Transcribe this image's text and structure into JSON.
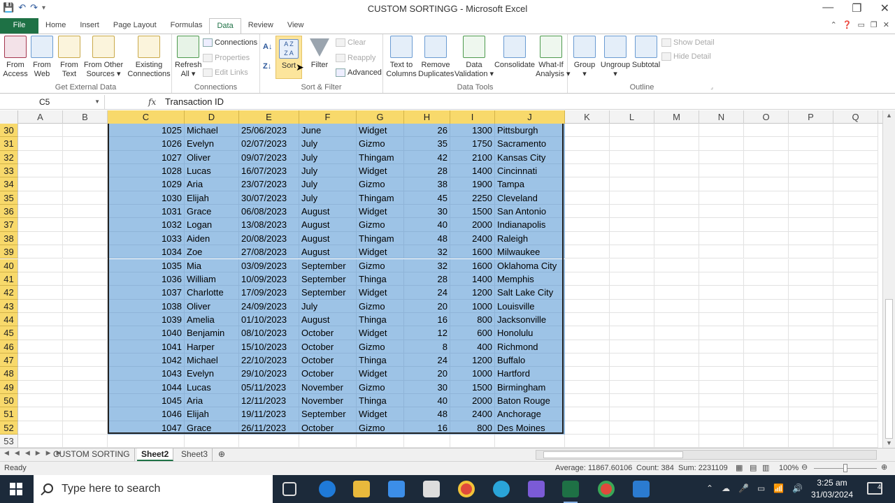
{
  "window": {
    "title": "CUSTOM SORTINGG - Microsoft Excel",
    "minimize": "—",
    "restore": "❐",
    "close": "✕"
  },
  "ribbon_tabs": [
    "File",
    "Home",
    "Insert",
    "Page Layout",
    "Formulas",
    "Data",
    "Review",
    "View"
  ],
  "active_tab": "Data",
  "ribbon": {
    "get_external_data": {
      "label": "Get External Data",
      "from_access": "From\nAccess",
      "from_web": "From\nWeb",
      "from_text": "From\nText",
      "from_other": "From Other\nSources ▾",
      "existing": "Existing\nConnections"
    },
    "connections": {
      "label": "Connections",
      "refresh": "Refresh\nAll ▾",
      "connections": "Connections",
      "properties": "Properties",
      "edit_links": "Edit Links"
    },
    "sort_filter": {
      "label": "Sort & Filter",
      "sort": "Sort",
      "filter": "Filter",
      "clear": "Clear",
      "reapply": "Reapply",
      "advanced": "Advanced"
    },
    "data_tools": {
      "label": "Data Tools",
      "text_to_columns": "Text to\nColumns",
      "remove_duplicates": "Remove\nDuplicates",
      "data_validation": "Data\nValidation ▾",
      "consolidate": "Consolidate",
      "what_if": "What-If\nAnalysis ▾"
    },
    "outline": {
      "label": "Outline",
      "group": "Group\n▾",
      "ungroup": "Ungroup\n▾",
      "subtotal": "Subtotal",
      "show_detail": "Show Detail",
      "hide_detail": "Hide Detail"
    }
  },
  "formula_bar": {
    "name_box": "C5",
    "fx": "fx",
    "formula": "Transaction ID"
  },
  "columns": [
    "A",
    "B",
    "C",
    "D",
    "E",
    "F",
    "G",
    "H",
    "I",
    "J",
    "K",
    "L",
    "M",
    "N",
    "O",
    "P",
    "Q"
  ],
  "rows": [
    {
      "n": "30",
      "cells": [
        "1025",
        "Michael",
        "25/06/2023",
        "June",
        "Widget",
        "26",
        "1300",
        "Pittsburgh"
      ]
    },
    {
      "n": "31",
      "cells": [
        "1026",
        "Evelyn",
        "02/07/2023",
        "July",
        "Gizmo",
        "35",
        "1750",
        "Sacramento"
      ]
    },
    {
      "n": "32",
      "cells": [
        "1027",
        "Oliver",
        "09/07/2023",
        "July",
        "Thingam",
        "42",
        "2100",
        "Kansas City"
      ]
    },
    {
      "n": "33",
      "cells": [
        "1028",
        "Lucas",
        "16/07/2023",
        "July",
        "Widget",
        "28",
        "1400",
        "Cincinnati"
      ]
    },
    {
      "n": "34",
      "cells": [
        "1029",
        "Aria",
        "23/07/2023",
        "July",
        "Gizmo",
        "38",
        "1900",
        "Tampa"
      ]
    },
    {
      "n": "35",
      "cells": [
        "1030",
        "Elijah",
        "30/07/2023",
        "July",
        "Thingam",
        "45",
        "2250",
        "Cleveland"
      ]
    },
    {
      "n": "36",
      "cells": [
        "1031",
        "Grace",
        "06/08/2023",
        "August",
        "Widget",
        "30",
        "1500",
        "San Antonio"
      ]
    },
    {
      "n": "37",
      "cells": [
        "1032",
        "Logan",
        "13/08/2023",
        "August",
        "Gizmo",
        "40",
        "2000",
        "Indianapolis"
      ]
    },
    {
      "n": "38",
      "cells": [
        "1033",
        "Aiden",
        "20/08/2023",
        "August",
        "Thingam",
        "48",
        "2400",
        "Raleigh"
      ]
    },
    {
      "n": "39",
      "cells": [
        "1034",
        "Zoe",
        "27/08/2023",
        "August",
        "Widget",
        "32",
        "1600",
        "Milwaukee"
      ]
    },
    {
      "n": "40",
      "cells": [
        "1035",
        "Mia",
        "03/09/2023",
        "September",
        "Gizmo",
        "32",
        "1600",
        "Oklahoma City"
      ]
    },
    {
      "n": "41",
      "cells": [
        "1036",
        "William",
        "10/09/2023",
        "September",
        "Thinga",
        "28",
        "1400",
        "Memphis"
      ]
    },
    {
      "n": "42",
      "cells": [
        "1037",
        "Charlotte",
        "17/09/2023",
        "September",
        "Widget",
        "24",
        "1200",
        "Salt Lake City"
      ]
    },
    {
      "n": "43",
      "cells": [
        "1038",
        "Oliver",
        "24/09/2023",
        "July",
        "Gizmo",
        "20",
        "1000",
        "Louisville"
      ]
    },
    {
      "n": "44",
      "cells": [
        "1039",
        "Amelia",
        "01/10/2023",
        "August",
        "Thinga",
        "16",
        "800",
        "Jacksonville"
      ]
    },
    {
      "n": "45",
      "cells": [
        "1040",
        "Benjamin",
        "08/10/2023",
        "October",
        "Widget",
        "12",
        "600",
        "Honolulu"
      ]
    },
    {
      "n": "46",
      "cells": [
        "1041",
        "Harper",
        "15/10/2023",
        "October",
        "Gizmo",
        "8",
        "400",
        "Richmond"
      ]
    },
    {
      "n": "47",
      "cells": [
        "1042",
        "Michael",
        "22/10/2023",
        "October",
        "Thinga",
        "24",
        "1200",
        "Buffalo"
      ]
    },
    {
      "n": "48",
      "cells": [
        "1043",
        "Evelyn",
        "29/10/2023",
        "October",
        "Widget",
        "20",
        "1000",
        "Hartford"
      ]
    },
    {
      "n": "49",
      "cells": [
        "1044",
        "Lucas",
        "05/11/2023",
        "November",
        "Gizmo",
        "30",
        "1500",
        "Birmingham"
      ]
    },
    {
      "n": "50",
      "cells": [
        "1045",
        "Aria",
        "12/11/2023",
        "November",
        "Thinga",
        "40",
        "2000",
        "Baton Rouge"
      ]
    },
    {
      "n": "51",
      "cells": [
        "1046",
        "Elijah",
        "19/11/2023",
        "September",
        "Widget",
        "48",
        "2400",
        "Anchorage"
      ]
    },
    {
      "n": "52",
      "cells": [
        "1047",
        "Grace",
        "26/11/2023",
        "October",
        "Gizmo",
        "16",
        "800",
        "Des Moines"
      ]
    },
    {
      "n": "53",
      "cells": [
        "",
        "",
        "",
        "",
        "",
        "",
        "",
        ""
      ]
    }
  ],
  "sheet_tabs": [
    "CUSTOM SORTING",
    "Sheet2",
    "Sheet3"
  ],
  "active_sheet": "Sheet2",
  "status": {
    "ready": "Ready",
    "average": "Average: 11867.60106",
    "count": "Count: 384",
    "sum": "Sum: 2231109",
    "zoom": "100%"
  },
  "taskbar": {
    "search_placeholder": "Type here to search",
    "time": "3:25 am",
    "date": "31/03/2024",
    "notifications": "4"
  },
  "colors": {
    "excel_green": "#1e7145",
    "selection_fill": "#9dc3e6",
    "header_highlight": "#f8d96b",
    "taskbar": "#1c2a3a"
  }
}
